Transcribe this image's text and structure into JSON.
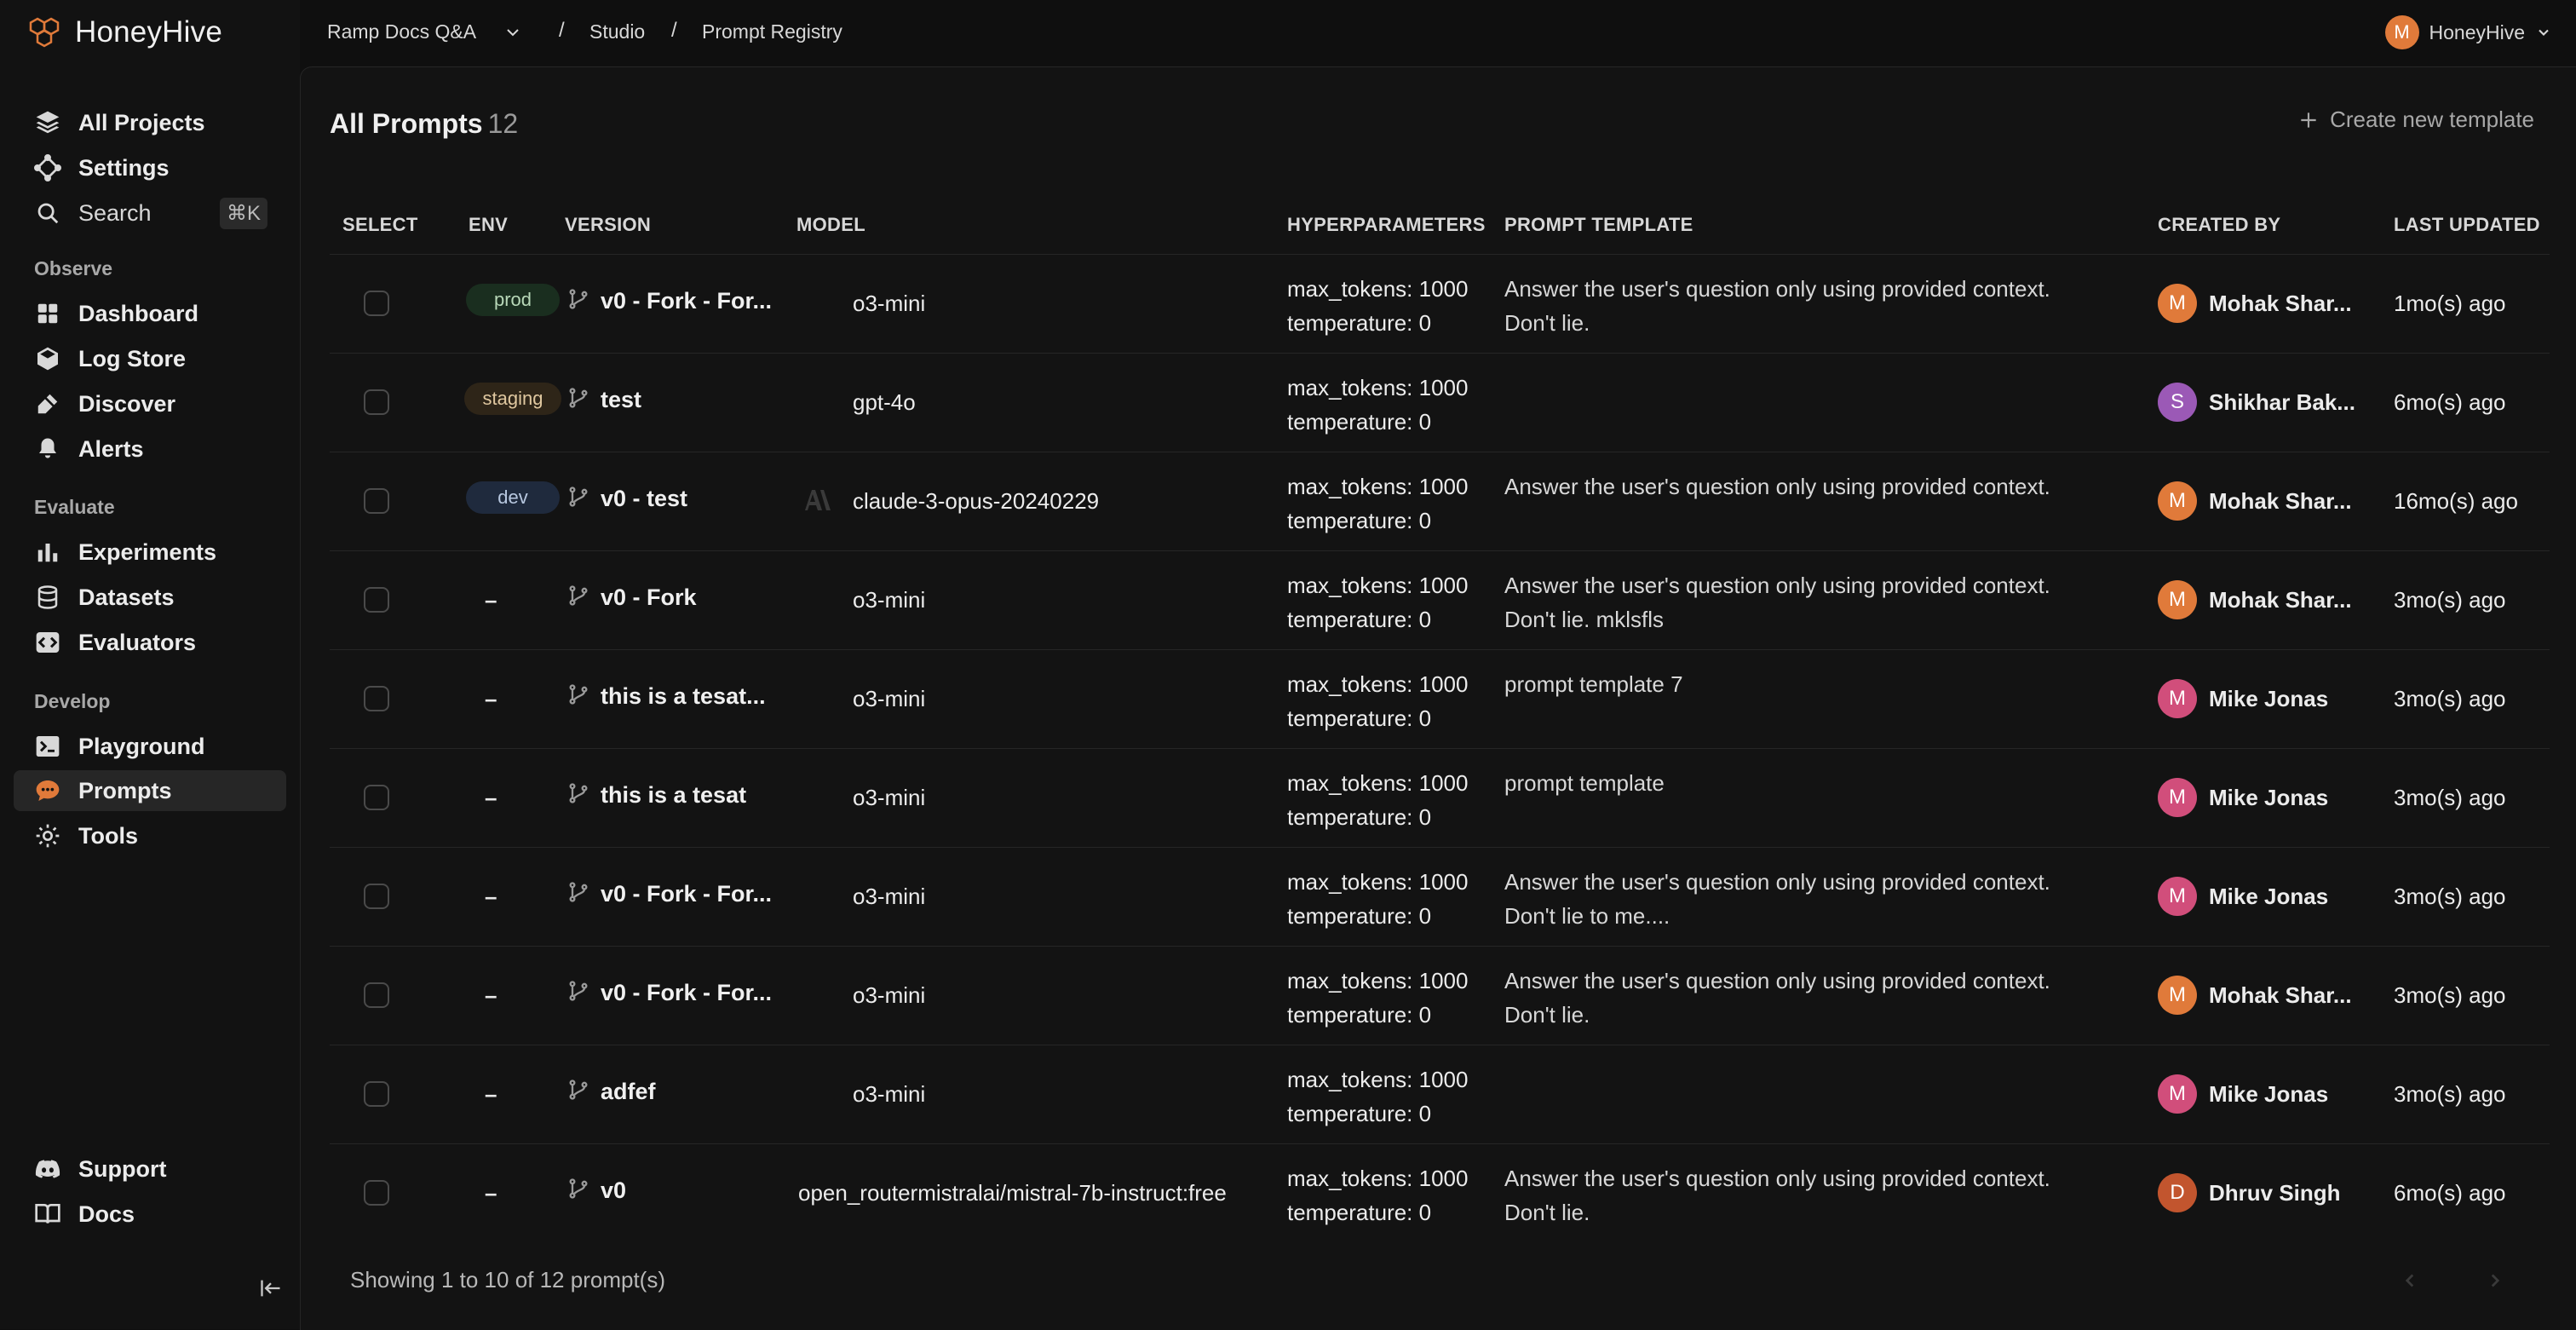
{
  "app": {
    "name": "HoneyHive"
  },
  "breadcrumb": {
    "project": "Ramp Docs Q&A",
    "studio": "Studio",
    "page": "Prompt Registry",
    "sep": "/"
  },
  "user": {
    "initial": "M",
    "name": "HoneyHive"
  },
  "sidebar": {
    "top_items": [
      {
        "label": "All Projects",
        "icon": "layers-icon"
      },
      {
        "label": "Settings",
        "icon": "settings-icon"
      },
      {
        "label": "Search",
        "icon": "search-icon",
        "shortcut": "⌘K"
      }
    ],
    "sections": [
      {
        "label": "Observe",
        "items": [
          {
            "label": "Dashboard",
            "icon": "dashboard-icon"
          },
          {
            "label": "Log Store",
            "icon": "log-store-icon"
          },
          {
            "label": "Discover",
            "icon": "discover-icon"
          },
          {
            "label": "Alerts",
            "icon": "bell-icon"
          }
        ]
      },
      {
        "label": "Evaluate",
        "items": [
          {
            "label": "Experiments",
            "icon": "bar-chart-icon"
          },
          {
            "label": "Datasets",
            "icon": "database-icon"
          },
          {
            "label": "Evaluators",
            "icon": "code-icon"
          }
        ]
      },
      {
        "label": "Develop",
        "items": [
          {
            "label": "Playground",
            "icon": "terminal-icon"
          },
          {
            "label": "Prompts",
            "icon": "chat-bubble-icon",
            "active": true
          },
          {
            "label": "Tools",
            "icon": "tools-icon"
          }
        ]
      }
    ],
    "bottom_items": [
      {
        "label": "Support",
        "icon": "discord-icon"
      },
      {
        "label": "Docs",
        "icon": "book-icon"
      }
    ]
  },
  "page": {
    "title": "All Prompts",
    "count": "12",
    "create_label": "Create new template"
  },
  "table": {
    "headers": [
      "SELECT",
      "ENV",
      "VERSION",
      "MODEL",
      "HYPERPARAMETERS",
      "PROMPT TEMPLATE",
      "CREATED BY",
      "LAST UPDATED"
    ],
    "rows": [
      {
        "env": "prod",
        "version": "v0 - Fork - For...",
        "model": "o3-mini",
        "model_icon": "",
        "hyper1": "max_tokens: 1000",
        "hyper2": "temperature: 0",
        "prompt1": "Answer the user's question only using provided context.",
        "prompt2": "Don't lie.",
        "initial": "M",
        "creator": "Mohak Shar...",
        "updated": "1mo(s) ago"
      },
      {
        "env": "staging",
        "version": "test",
        "model": "gpt-4o",
        "model_icon": "",
        "hyper1": "max_tokens: 1000",
        "hyper2": "temperature: 0",
        "prompt1": "",
        "prompt2": "",
        "initial": "S",
        "creator": "Shikhar Bak...",
        "updated": "6mo(s) ago"
      },
      {
        "env": "dev",
        "version": "v0 - test",
        "model": "claude-3-opus-20240229",
        "model_icon": "anthropic-icon",
        "hyper1": "max_tokens: 1000",
        "hyper2": "temperature: 0",
        "prompt1": "Answer the user's question only using provided context.",
        "prompt2": "",
        "initial": "M",
        "creator": "Mohak Shar...",
        "updated": "16mo(s) ago"
      },
      {
        "env": "–",
        "version": "v0 - Fork",
        "model": "o3-mini",
        "model_icon": "",
        "hyper1": "max_tokens: 1000",
        "hyper2": "temperature: 0",
        "prompt1": "Answer the user's question only using provided context.",
        "prompt2": "Don't lie. mklsfls",
        "initial": "M",
        "creator": "Mohak Shar...",
        "updated": "3mo(s) ago"
      },
      {
        "env": "–",
        "version": "this is a tesat...",
        "model": "o3-mini",
        "model_icon": "",
        "hyper1": "max_tokens: 1000",
        "hyper2": "temperature: 0",
        "prompt1": "prompt template 7",
        "prompt2": "",
        "initial": "M",
        "creator": "Mike Jonas",
        "updated": "3mo(s) ago"
      },
      {
        "env": "–",
        "version": "this is a tesat",
        "model": "o3-mini",
        "model_icon": "",
        "hyper1": "max_tokens: 1000",
        "hyper2": "temperature: 0",
        "prompt1": "prompt template",
        "prompt2": "",
        "initial": "M",
        "creator": "Mike Jonas",
        "updated": "3mo(s) ago"
      },
      {
        "env": "–",
        "version": "v0 - Fork - For...",
        "model": "o3-mini",
        "model_icon": "",
        "hyper1": "max_tokens: 1000",
        "hyper2": "temperature: 0",
        "prompt1": "Answer the user's question only using provided context.",
        "prompt2": "Don't lie to me....",
        "initial": "M",
        "creator": "Mike Jonas",
        "updated": "3mo(s) ago"
      },
      {
        "env": "–",
        "version": "v0 - Fork - For...",
        "model": "o3-mini",
        "model_icon": "",
        "hyper1": "max_tokens: 1000",
        "hyper2": "temperature: 0",
        "prompt1": "Answer the user's question only using provided context.",
        "prompt2": "Don't lie.",
        "initial": "M",
        "creator": "Mohak Shar...",
        "updated": "3mo(s) ago"
      },
      {
        "env": "–",
        "version": "adfef",
        "model": "o3-mini",
        "model_icon": "",
        "hyper1": "max_tokens: 1000",
        "hyper2": "temperature: 0",
        "prompt1": "",
        "prompt2": "",
        "initial": "M",
        "creator": "Mike Jonas",
        "updated": "3mo(s) ago"
      },
      {
        "env": "–",
        "version": "v0",
        "model": "open_routermistralai/mistral-7b-instruct:free",
        "model_icon": "",
        "hyper1": "max_tokens: 1000",
        "hyper2": "temperature: 0",
        "prompt1": "Answer the user's question only using provided context.",
        "prompt2": "Don't lie.",
        "initial": "D",
        "creator": "Dhruv Singh",
        "updated": "6mo(s) ago"
      }
    ]
  },
  "footer": {
    "showing": "Showing 1 to 10 of 12 prompt(s)"
  },
  "colors": {
    "avatar_mohak": "#e07a3a",
    "avatar_shikhar": "#9b59b6",
    "avatar_mike": "#d14e7b",
    "avatar_dhruv": "#c2552e",
    "prod_bg": "#1a2e1f",
    "prod_fg": "#b8d8b8",
    "staging_bg": "#2e2518",
    "staging_fg": "#e0c8a0",
    "dev_bg": "#1f2a3d",
    "dev_fg": "#b8c8e0",
    "brand": "#e07a3a"
  }
}
